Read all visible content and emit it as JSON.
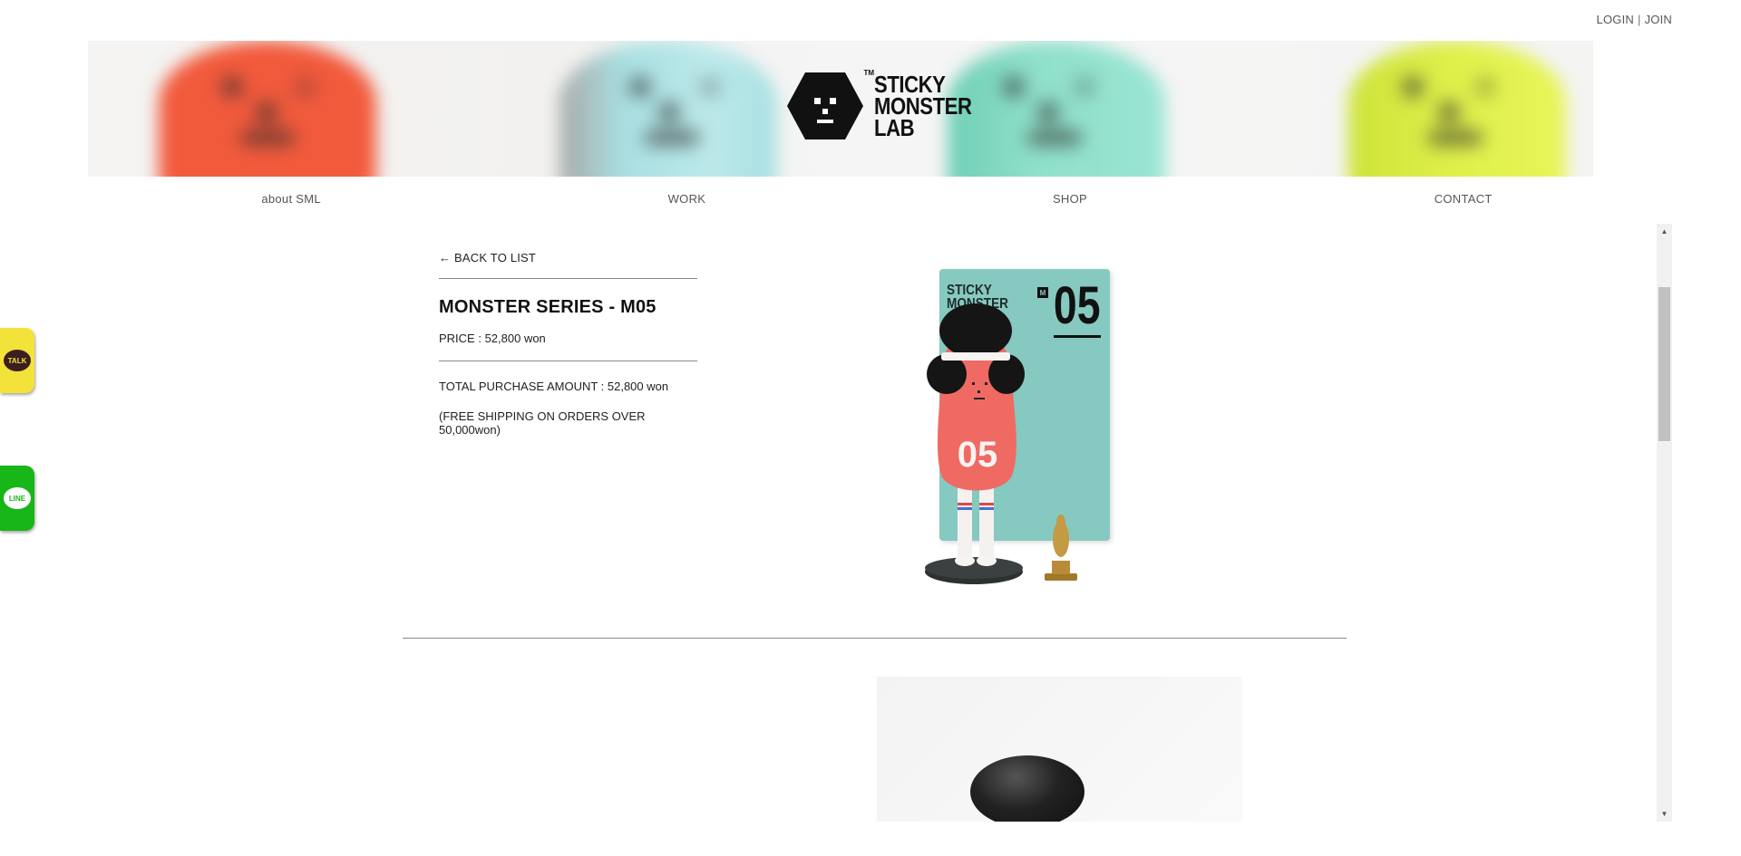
{
  "header": {
    "login_label": "LOGIN",
    "separator": "|",
    "join_label": "JOIN"
  },
  "banner": {
    "logo_text": [
      "STICKY",
      "MONSTER",
      "LAB"
    ],
    "logo_tm": "TM",
    "monster_colors": [
      "#f25a3c",
      "#9fdedf",
      "#6fcfb6",
      "#d8ea3a"
    ]
  },
  "nav": {
    "items": [
      "about SML",
      "WORK",
      "SHOP",
      "CONTACT"
    ]
  },
  "side_buttons": {
    "kakao_label": "TALK",
    "line_label": "LINE",
    "kakao_color": "#f2e23a",
    "line_color": "#19b619"
  },
  "product": {
    "back_label": "← BACK TO LIST",
    "title": "MONSTER SERIES - M05",
    "price": "PRICE : 52,800 won",
    "total": "TOTAL PURCHASE AMOUNT : 52,800 won",
    "shipping": "(FREE SHIPPING ON ORDERS OVER 50,000won)",
    "box_brand": [
      "STICKY",
      "MONSTER"
    ],
    "box_m": "M",
    "box_number": "05",
    "figure_number": "05"
  },
  "colors": {
    "accent_box": "#86c9c0",
    "figure_body": "#f06a64"
  }
}
